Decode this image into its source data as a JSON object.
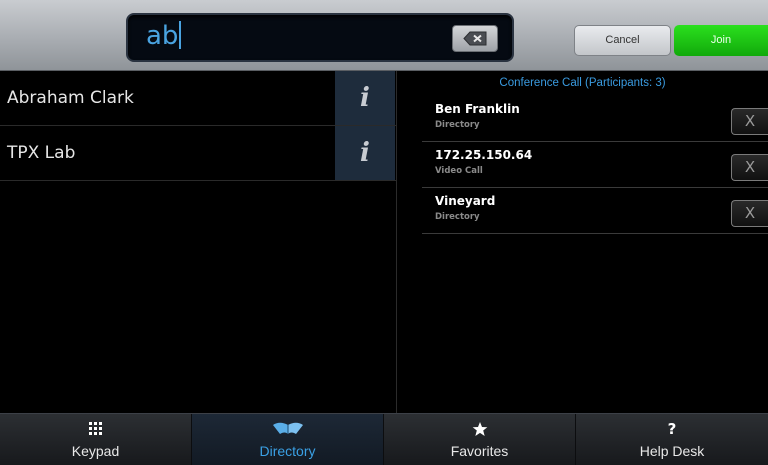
{
  "search": {
    "value": "ab"
  },
  "actions": {
    "cancel_label": "Cancel",
    "join_label": "Join"
  },
  "directory": {
    "items": [
      {
        "name": "Abraham Clark"
      },
      {
        "name": "TPX Lab"
      }
    ]
  },
  "conference": {
    "header": "Conference Call (Participants: 3)",
    "participants": [
      {
        "name": "Ben Franklin",
        "type": "Directory",
        "remove_label": "X"
      },
      {
        "name": "172.25.150.64",
        "type": "Video Call",
        "remove_label": "X"
      },
      {
        "name": "Vineyard",
        "type": "Directory",
        "remove_label": "X"
      }
    ]
  },
  "nav": {
    "tabs": [
      {
        "label": "Keypad",
        "icon": "keypad-icon"
      },
      {
        "label": "Directory",
        "icon": "directory-book-icon",
        "active": true
      },
      {
        "label": "Favorites",
        "icon": "star-icon"
      },
      {
        "label": "Help Desk",
        "icon": "question-mark-icon",
        "glyph": "?"
      }
    ]
  },
  "colors": {
    "accent_blue": "#3aa0e4",
    "join_green": "#1dc815",
    "info_button_bg": "#1e2c3c"
  }
}
